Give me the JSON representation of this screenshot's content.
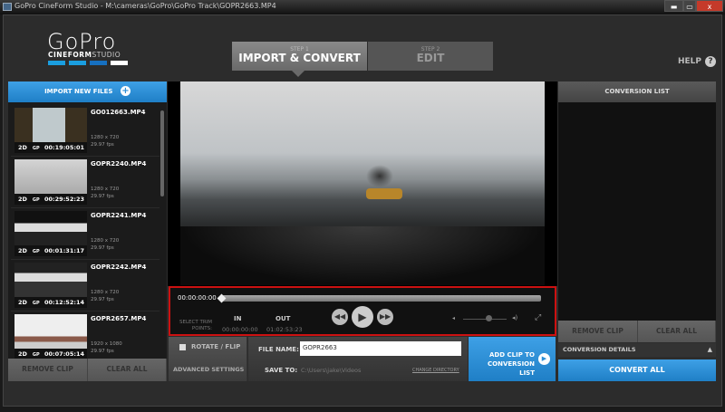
{
  "window": {
    "title": "GoPro CineForm Studio - M:\\cameras\\GoPro\\GoPro Track\\GOPR2663.MP4",
    "minimize": "▬",
    "maximize": "▭",
    "close": "x"
  },
  "logo": {
    "brand": "GoPro",
    "sub_bold": "CINEFORM",
    "sub_light": "STUDIO",
    "colors": [
      "#1a9ee0",
      "#1a9ee0",
      "#1670c0",
      "#ffffff"
    ]
  },
  "steps": [
    {
      "step": "STEP 1",
      "label": "IMPORT & CONVERT",
      "active": true
    },
    {
      "step": "STEP 2",
      "label": "EDIT",
      "active": false
    }
  ],
  "help": {
    "label": "HELP",
    "icon": "?"
  },
  "left": {
    "import_label": "IMPORT NEW FILES",
    "import_icon": "+",
    "clips": [
      {
        "name": "GO012663.MP4",
        "mode": "2D",
        "cam": "GP",
        "duration": "00:19:05:01",
        "resolution": "1280 x 720",
        "fps": "29.97 fps"
      },
      {
        "name": "GOPR2240.MP4",
        "mode": "2D",
        "cam": "GP",
        "duration": "00:29:52:23",
        "resolution": "1280 x 720",
        "fps": "29.97 fps"
      },
      {
        "name": "GOPR2241.MP4",
        "mode": "2D",
        "cam": "GP",
        "duration": "00:01:31:17",
        "resolution": "1280 x 720",
        "fps": "29.97 fps"
      },
      {
        "name": "GOPR2242.MP4",
        "mode": "2D",
        "cam": "GP",
        "duration": "00:12:52:14",
        "resolution": "1280 x 720",
        "fps": "29.97 fps"
      },
      {
        "name": "GOPR2657.MP4",
        "mode": "2D",
        "cam": "GP",
        "duration": "00:07:05:14",
        "resolution": "1920 x 1080",
        "fps": "29.97 fps"
      }
    ],
    "remove_clip": "REMOVE CLIP",
    "clear_all": "CLEAR ALL"
  },
  "player": {
    "timecode": "00:00:00:00",
    "progress": 0,
    "select_trim": "SELECT TRIM POINTS:",
    "in_label": "IN",
    "in_value": "00:00:00:00",
    "out_label": "OUT",
    "out_value": "01:02:53:23",
    "volume": 0.55,
    "accent": "#cc1111"
  },
  "settings": {
    "rotate_flip": "ROTATE / FLIP",
    "rotate_checked": false,
    "advanced": "ADVANCED SETTINGS",
    "file_name_label": "FILE NAME:",
    "file_name": "GOPR2663",
    "save_to_label": "SAVE TO:",
    "save_to": "C:\\Users\\jake\\Videos",
    "change_directory": "CHANGE DIRECTORY",
    "add_clip": "ADD CLIP TO CONVERSION LIST"
  },
  "right": {
    "header": "CONVERSION LIST",
    "remove_clip": "REMOVE CLIP",
    "clear_all": "CLEAR ALL",
    "details": "CONVERSION DETAILS",
    "convert_all": "CONVERT ALL"
  }
}
